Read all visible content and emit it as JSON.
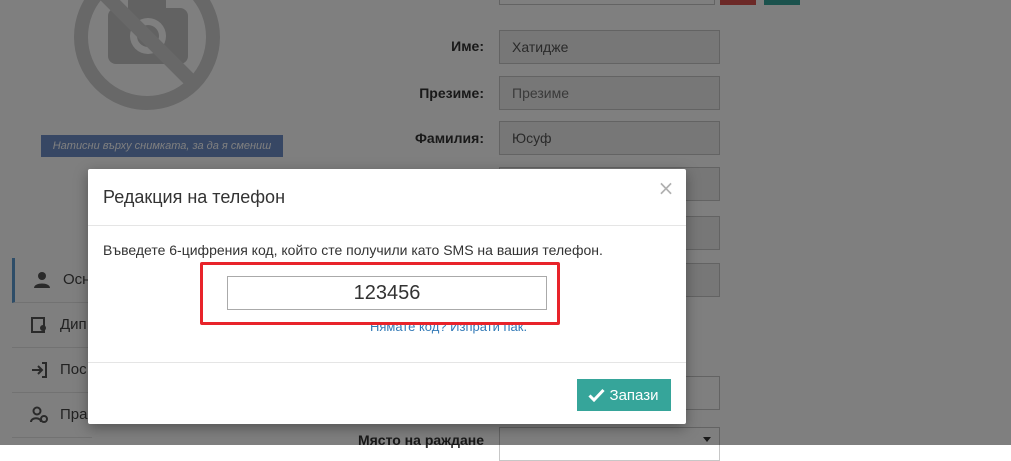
{
  "profile": {
    "photo_hint": "Натисни върху снимката, за да я смениш",
    "photo_icon": "no-camera-icon"
  },
  "form": {
    "fields": [
      {
        "label": "Име:",
        "value": "Хатидже",
        "placeholder": ""
      },
      {
        "label": "Презиме:",
        "value": "",
        "placeholder": "Презиме"
      },
      {
        "label": "Фамилия:",
        "value": "Юсуф",
        "placeholder": ""
      }
    ],
    "birthplace_label": "Място на раждане"
  },
  "sidebar": {
    "items": [
      {
        "label": "Осн",
        "icon": "user-icon",
        "active": true
      },
      {
        "label": "Дип",
        "icon": "diploma-icon",
        "active": false
      },
      {
        "label": "Пос",
        "icon": "sign-in-icon",
        "active": false
      },
      {
        "label": "Пра",
        "icon": "users-cog-icon",
        "active": false
      }
    ]
  },
  "modal": {
    "title": "Редакция на телефон",
    "close_symbol": "×",
    "instructions": "Въведете 6-цифрения код, който сте получили като SMS на вашия телефон.",
    "code_value": "123456",
    "resend_link": "Нямате код? Изпрати пак.",
    "save_label": "Запази"
  },
  "colors": {
    "accent_teal": "#36a59a",
    "highlight_red": "#e8232a",
    "hint_blue": "#6f8fc9",
    "link_blue": "#337ab7"
  }
}
